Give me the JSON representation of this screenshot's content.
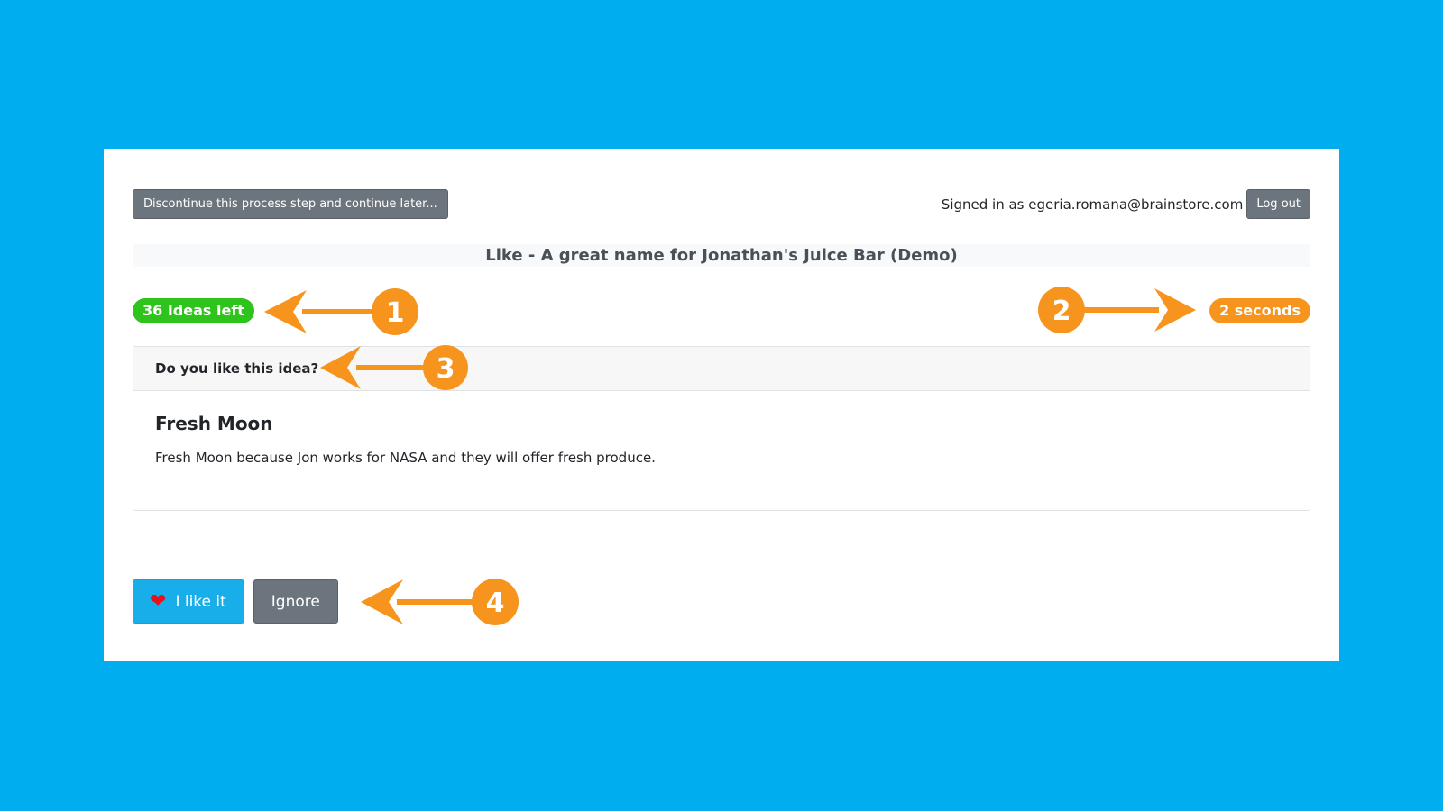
{
  "toolbar": {
    "discontinue_label": "Discontinue this process step and continue later...",
    "signed_in_text": "Signed in as egeria.romana@brainstore.com",
    "logout_label": "Log out"
  },
  "page": {
    "title": "Like - A great name for Jonathan's Juice Bar (Demo)"
  },
  "status": {
    "ideas_left": "36 Ideas left",
    "timer": "2 seconds"
  },
  "idea_panel": {
    "question": "Do you like this idea?",
    "idea_title": "Fresh Moon",
    "idea_description": "Fresh Moon because Jon works for NASA and they will offer fresh produce."
  },
  "actions": {
    "like_label": "I like it",
    "ignore_label": "Ignore"
  },
  "annotations": {
    "marker_1": "1",
    "marker_2": "2",
    "marker_3": "3",
    "marker_4": "4"
  },
  "colors": {
    "background": "#00adef",
    "ideas_badge": "#2ec41b",
    "timer_badge": "#f7941d",
    "like_button": "#17aeea",
    "annotation": "#f7941d"
  }
}
